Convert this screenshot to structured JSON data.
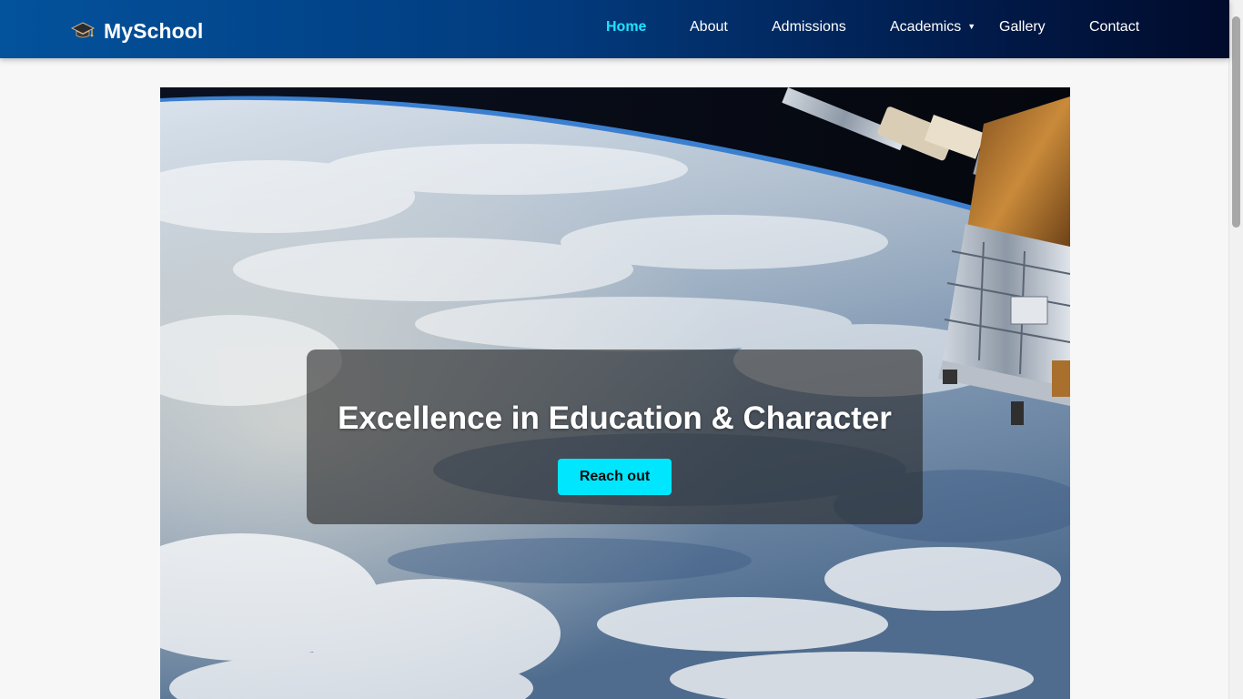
{
  "brand": {
    "name": "MySchool",
    "icon": "graduation-cap-icon"
  },
  "nav": {
    "items": [
      {
        "label": "Home",
        "active": true
      },
      {
        "label": "About",
        "active": false
      },
      {
        "label": "Admissions",
        "active": false
      },
      {
        "label": "Academics",
        "active": false,
        "has_dropdown": true,
        "caret": "▼"
      },
      {
        "label": "Gallery",
        "active": false
      },
      {
        "label": "Contact",
        "active": false
      }
    ]
  },
  "hero": {
    "title": "Excellence in Education & Character",
    "button_label": "Reach out"
  },
  "colors": {
    "nav_gradient_start": "#03529c",
    "nav_gradient_end": "#010b2b",
    "active_link": "#1ee3ff",
    "button": "#00e6ff",
    "page_background": "#f7f7f7"
  }
}
